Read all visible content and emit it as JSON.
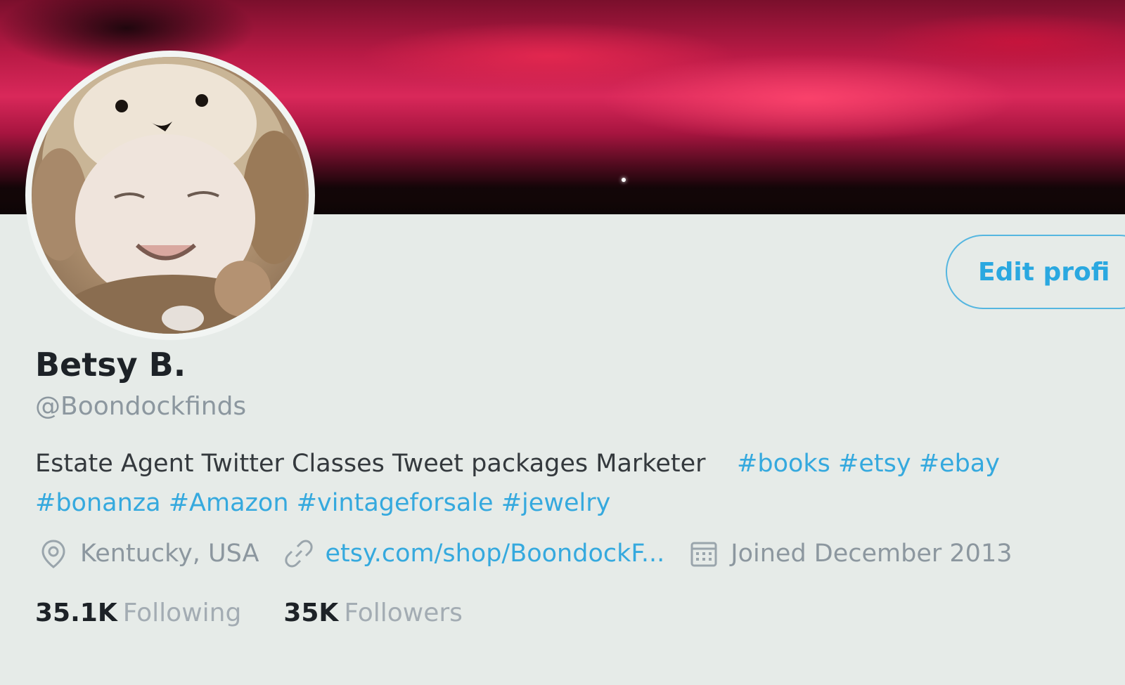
{
  "profile": {
    "name": "Betsy B.",
    "handle": "@Boondockfinds",
    "edit_button": "Edit profi",
    "bio_text": "Estate Agent Twitter Classes Tweet packages Marketer",
    "hashtags": [
      "#books",
      "#etsy",
      "#ebay",
      "#bonanza",
      "#Amazon",
      "#vintageforsale",
      "#jewelry"
    ],
    "location": "Kentucky, USA",
    "link": "etsy.com/shop/BoondockF...",
    "joined": "Joined December 2013",
    "following_count": "35.1K",
    "following_label": "Following",
    "followers_count": "35K",
    "followers_label": "Followers"
  },
  "icons": {
    "location": "location-pin-icon",
    "link": "link-icon",
    "calendar": "calendar-icon"
  },
  "colors": {
    "accent": "#35a9de",
    "text": "#1d2227",
    "muted": "#8c979f"
  }
}
